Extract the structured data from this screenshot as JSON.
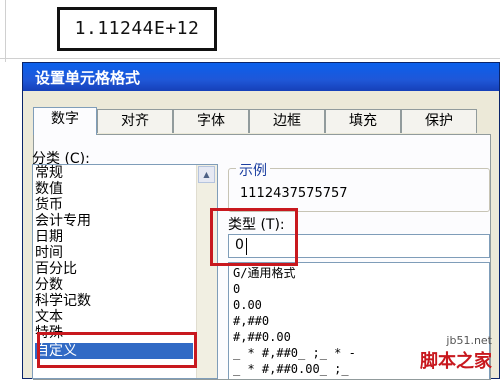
{
  "cell": {
    "value": "1.11244E+12"
  },
  "dialog": {
    "title": "设置单元格格式",
    "tabs": [
      "数字",
      "对齐",
      "字体",
      "边框",
      "填充",
      "保护"
    ],
    "active_tab": "数字",
    "category_label": "分类 (C):",
    "categories": [
      "常规",
      "数值",
      "货币",
      "会计专用",
      "日期",
      "时间",
      "百分比",
      "分数",
      "科学记数",
      "文本",
      "特殊",
      "自定义"
    ],
    "selected_category": "自定义",
    "sample_label": "示例",
    "sample_value": "1112437575757",
    "type_label": "类型 (T):",
    "type_value": "0",
    "formats": [
      "G/通用格式",
      "0",
      "0.00",
      "#,##0",
      "#,##0.00",
      "_ * #,##0_ ;_ * -",
      "_ * #,##0.00_ ;_"
    ]
  },
  "watermark": {
    "site": "jb51.net",
    "brand": "脚本之家"
  },
  "colors": {
    "title_bar": "#0a60ec",
    "highlight_box": "#c8181e",
    "selection": "#316ac5"
  }
}
